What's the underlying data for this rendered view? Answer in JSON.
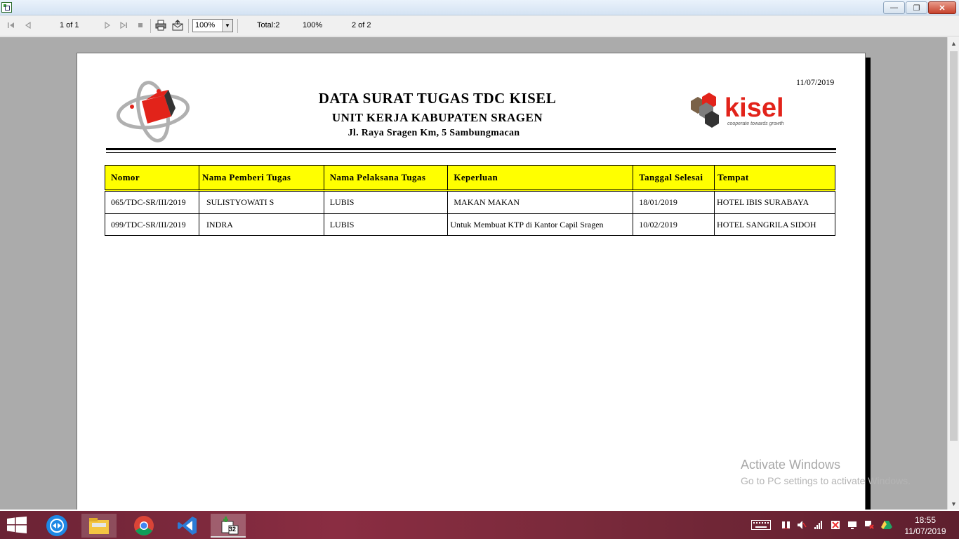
{
  "toolbar": {
    "page_indicator": "1 of 1",
    "zoom_value": "100%",
    "total": "Total:2",
    "percent": "100%",
    "records": "2 of 2"
  },
  "report": {
    "date": "11/07/2019",
    "title": "DATA SURAT TUGAS TDC KISEL",
    "subtitle": "UNIT KERJA KABUPATEN SRAGEN",
    "address": "Jl. Raya Sragen Km, 5 Sambungmacan",
    "logo_right_text": "kisel",
    "logo_right_tagline": "cooperate towards growth",
    "columns": [
      "Nomor",
      "Nama Pemberi Tugas",
      "Nama Pelaksana Tugas",
      "Keperluan",
      "Tanggal Selesai",
      "Tempat"
    ],
    "rows": [
      [
        "065/TDC-SR/III/2019",
        "SULISTYOWATI S",
        "LUBIS",
        "MAKAN MAKAN",
        "18/01/2019",
        "HOTEL IBIS SURABAYA"
      ],
      [
        "099/TDC-SR/III/2019",
        "INDRA",
        "LUBIS",
        "Untuk Membuat KTP di Kantor Capil Sragen",
        "10/02/2019",
        "HOTEL SANGRILA SIDOH"
      ]
    ]
  },
  "watermark": {
    "line1": "Activate Windows",
    "line2": "Go to PC settings to activate Windows."
  },
  "taskbar": {
    "time": "18:55",
    "date": "11/07/2019",
    "app_badge": "32"
  }
}
